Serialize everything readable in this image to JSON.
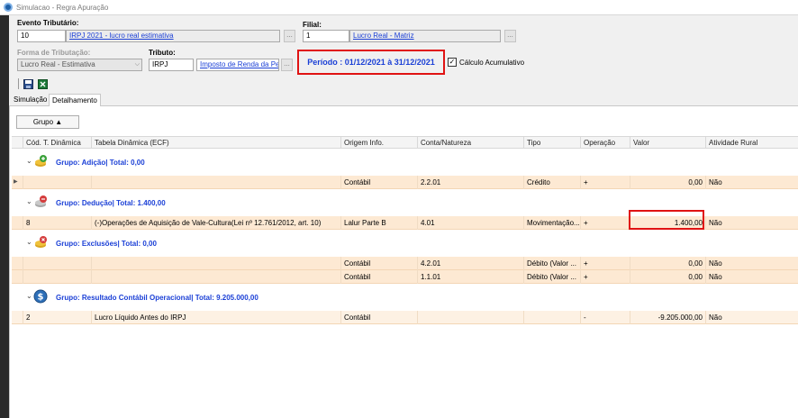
{
  "window": {
    "title": "Simulacao - Regra Apuração"
  },
  "form": {
    "evento_label": "Evento Tributário:",
    "evento_code": "10",
    "evento_desc": "IRPJ 2021 - lucro real estimativa",
    "filial_label": "Filial:",
    "filial_code": "1",
    "filial_desc": "Lucro Real - Matriz",
    "forma_label": "Forma de Tributação:",
    "forma_value": "Lucro Real - Estimativa",
    "tributo_label": "Tributo:",
    "tributo_code": "IRPJ",
    "tributo_desc": "Imposto de Renda da Pe",
    "periodo": "Período : 01/12/2021 à 31/12/2021",
    "calculo_label": "Cálculo Acumulativo",
    "calculo_checked": "✓",
    "ellipsis": "..."
  },
  "toolbar": {
    "icons": [
      "save-icon",
      "excel-icon"
    ]
  },
  "tabs": [
    {
      "label": "Simulação"
    },
    {
      "label": "Detalhamento"
    }
  ],
  "grid": {
    "group_button": "Grupo ▲",
    "columns": [
      "Cód. T. Dinâmica",
      "Tabela Dinâmica (ECF)",
      "Origem Info.",
      "Conta/Natureza",
      "Tipo",
      "Operação",
      "Valor",
      "Atividade Rural"
    ],
    "groups": [
      {
        "title": "Grupo: Adição| Total: 0,00",
        "icon": "plus-coins-icon",
        "rows": [
          {
            "codigo": "",
            "tabela": "",
            "origem": "Contábil",
            "conta": "2.2.01",
            "tipo": "Crédito",
            "operacao": "+",
            "valor": "0,00",
            "rural": "Não"
          }
        ]
      },
      {
        "title": "Grupo: Dedução| Total: 1.400,00",
        "icon": "minus-coins-icon",
        "rows": [
          {
            "codigo": "8",
            "tabela": "(-)Operações de Aquisição de Vale-Cultura(Lei nº 12.761/2012, art. 10)",
            "origem": "Lalur Parte B",
            "conta": "4.01",
            "tipo": "Movimentação...",
            "operacao": "+",
            "valor": "1.400,00",
            "rural": "Não"
          }
        ]
      },
      {
        "title": "Grupo: Exclusões| Total: 0,00",
        "icon": "exclusion-coins-icon",
        "rows": [
          {
            "codigo": "",
            "tabela": "",
            "origem": "Contábil",
            "conta": "4.2.01",
            "tipo": "Débito (Valor ...",
            "operacao": "+",
            "valor": "0,00",
            "rural": "Não"
          },
          {
            "codigo": "",
            "tabela": "",
            "origem": "Contábil",
            "conta": "1.1.01",
            "tipo": "Débito (Valor ...",
            "operacao": "+",
            "valor": "0,00",
            "rural": "Não"
          }
        ]
      },
      {
        "title": "Grupo: Resultado Contábil Operacional| Total: 9.205.000,00",
        "icon": "dollar-icon",
        "rows": [
          {
            "codigo": "2",
            "tabela": "Lucro Líquido Antes do IRPJ",
            "origem": "Contábil",
            "conta": "",
            "tipo": "",
            "operacao": "-",
            "valor": "-9.205.000,00",
            "rural": "Não"
          }
        ]
      }
    ]
  },
  "colors": {
    "link": "#1a3fd6",
    "highlight": "#e01313",
    "row": "#fde9d3"
  }
}
